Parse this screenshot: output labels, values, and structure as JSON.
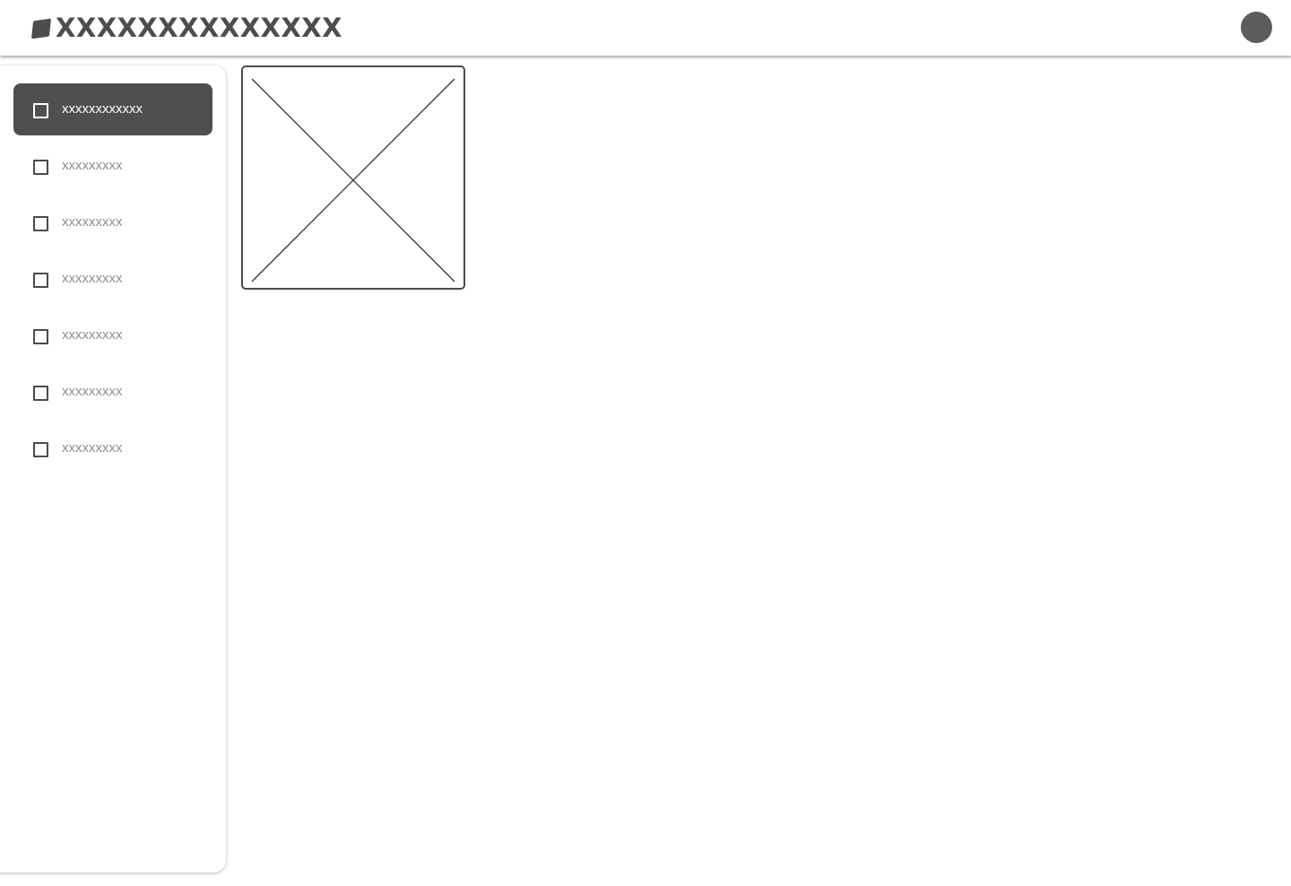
{
  "header": {
    "title": "XXXXXXXXXXXXXX",
    "logo_icon": "logo-mark-icon",
    "avatar_icon": "avatar-icon"
  },
  "sidebar": {
    "items": [
      {
        "label": "xxxxxxxxxxxx",
        "active": true,
        "icon": "square-icon"
      },
      {
        "label": "xxxxxxxxx",
        "active": false,
        "icon": "square-icon"
      },
      {
        "label": "xxxxxxxxx",
        "active": false,
        "icon": "square-icon"
      },
      {
        "label": "xxxxxxxxx",
        "active": false,
        "icon": "square-icon"
      },
      {
        "label": "xxxxxxxxx",
        "active": false,
        "icon": "square-icon"
      },
      {
        "label": "xxxxxxxxx",
        "active": false,
        "icon": "square-icon"
      },
      {
        "label": "xxxxxxxxx",
        "active": false,
        "icon": "square-icon"
      }
    ]
  },
  "main": {
    "image_placeholder_icon": "image-placeholder-icon"
  },
  "colors": {
    "active_bg": "#4f4f4f",
    "text_muted": "#8e8e8e",
    "text_dark": "#4d4d4d",
    "avatar": "#5c5c5c"
  }
}
